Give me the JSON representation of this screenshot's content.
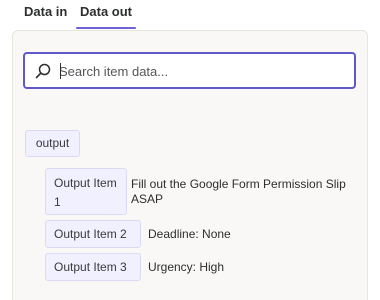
{
  "tabs": [
    {
      "label": "Data in",
      "active": false
    },
    {
      "label": "Data out",
      "active": true
    }
  ],
  "search": {
    "placeholder": "Search item data...",
    "value": "",
    "icon": "search-icon"
  },
  "tree": {
    "root_label": "output",
    "items": [
      {
        "key": "Output Item 1",
        "value": "Fill out the Google Form Permission Slip ASAP"
      },
      {
        "key": "Output Item 2",
        "value": "Deadline: None"
      },
      {
        "key": "Output Item 3",
        "value": "Urgency: High"
      }
    ]
  },
  "colors": {
    "accent": "#5f5ac8",
    "chip_bg": "#f1f0ff",
    "panel_bg": "#f9f8f6"
  }
}
